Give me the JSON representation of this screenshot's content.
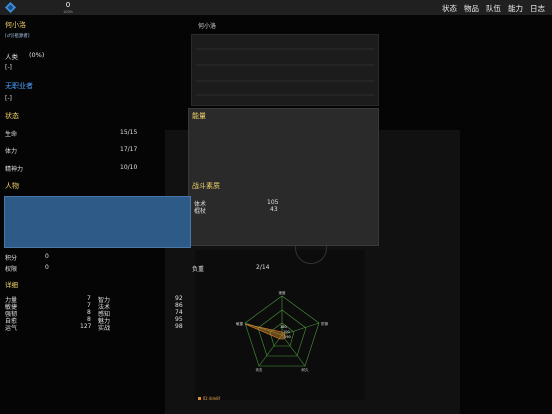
{
  "topbar": {
    "coins": "0",
    "coins_percent": "100%",
    "nav": [
      "状态",
      "物品",
      "队伍",
      "能力",
      "日志"
    ]
  },
  "character": {
    "name": "何小洛",
    "tag": "[♂][祖源者]",
    "race": "人类",
    "race_percent": "(0%)",
    "race_note": "[-]",
    "job": "无职业者",
    "job_note": "[-]"
  },
  "portrait_label": "何小洛",
  "status": {
    "title": "状态",
    "rows": [
      {
        "label": "生命",
        "value": "15/15"
      },
      {
        "label": "体力",
        "value": "17/17"
      },
      {
        "label": "精神力",
        "value": "10/10"
      }
    ]
  },
  "energy_title": "能量",
  "person_title": "人物",
  "combat": {
    "title": "战斗素质",
    "rows": [
      {
        "label": "体术",
        "value": "105"
      },
      {
        "label": "棍杖",
        "value": "43"
      }
    ]
  },
  "misc": {
    "points_label": "积分",
    "points_value": "0",
    "rights_label": "权限",
    "rights_value": "0",
    "weight_label": "负重",
    "weight_value": "2/14"
  },
  "details": {
    "title": "详细",
    "left": [
      {
        "label": "力量",
        "value": "7"
      },
      {
        "label": "敏捷",
        "value": "7"
      },
      {
        "label": "强韧",
        "value": "8"
      },
      {
        "label": "自愈",
        "value": "8"
      },
      {
        "label": "运气",
        "value": "127"
      }
    ],
    "right": [
      {
        "label": "智力",
        "value": "92"
      },
      {
        "label": "法术",
        "value": "86"
      },
      {
        "label": "感知",
        "value": "74"
      },
      {
        "label": "魅力",
        "value": "95"
      },
      {
        "label": "实战",
        "value": "98"
      }
    ]
  },
  "radar": {
    "axes": [
      "敏捷",
      "速度",
      "防御",
      "耐久",
      "攻击"
    ],
    "center_values": [
      "180",
      "100",
      "190"
    ],
    "legend": "ID:4de8f"
  },
  "colors": {
    "accent_yellow": "#f0d26a",
    "accent_blue": "#4aa3ff",
    "bar_blue": "#2e5a87",
    "radar_green": "#4a9a3a",
    "radar_orange": "#e08a2e"
  }
}
